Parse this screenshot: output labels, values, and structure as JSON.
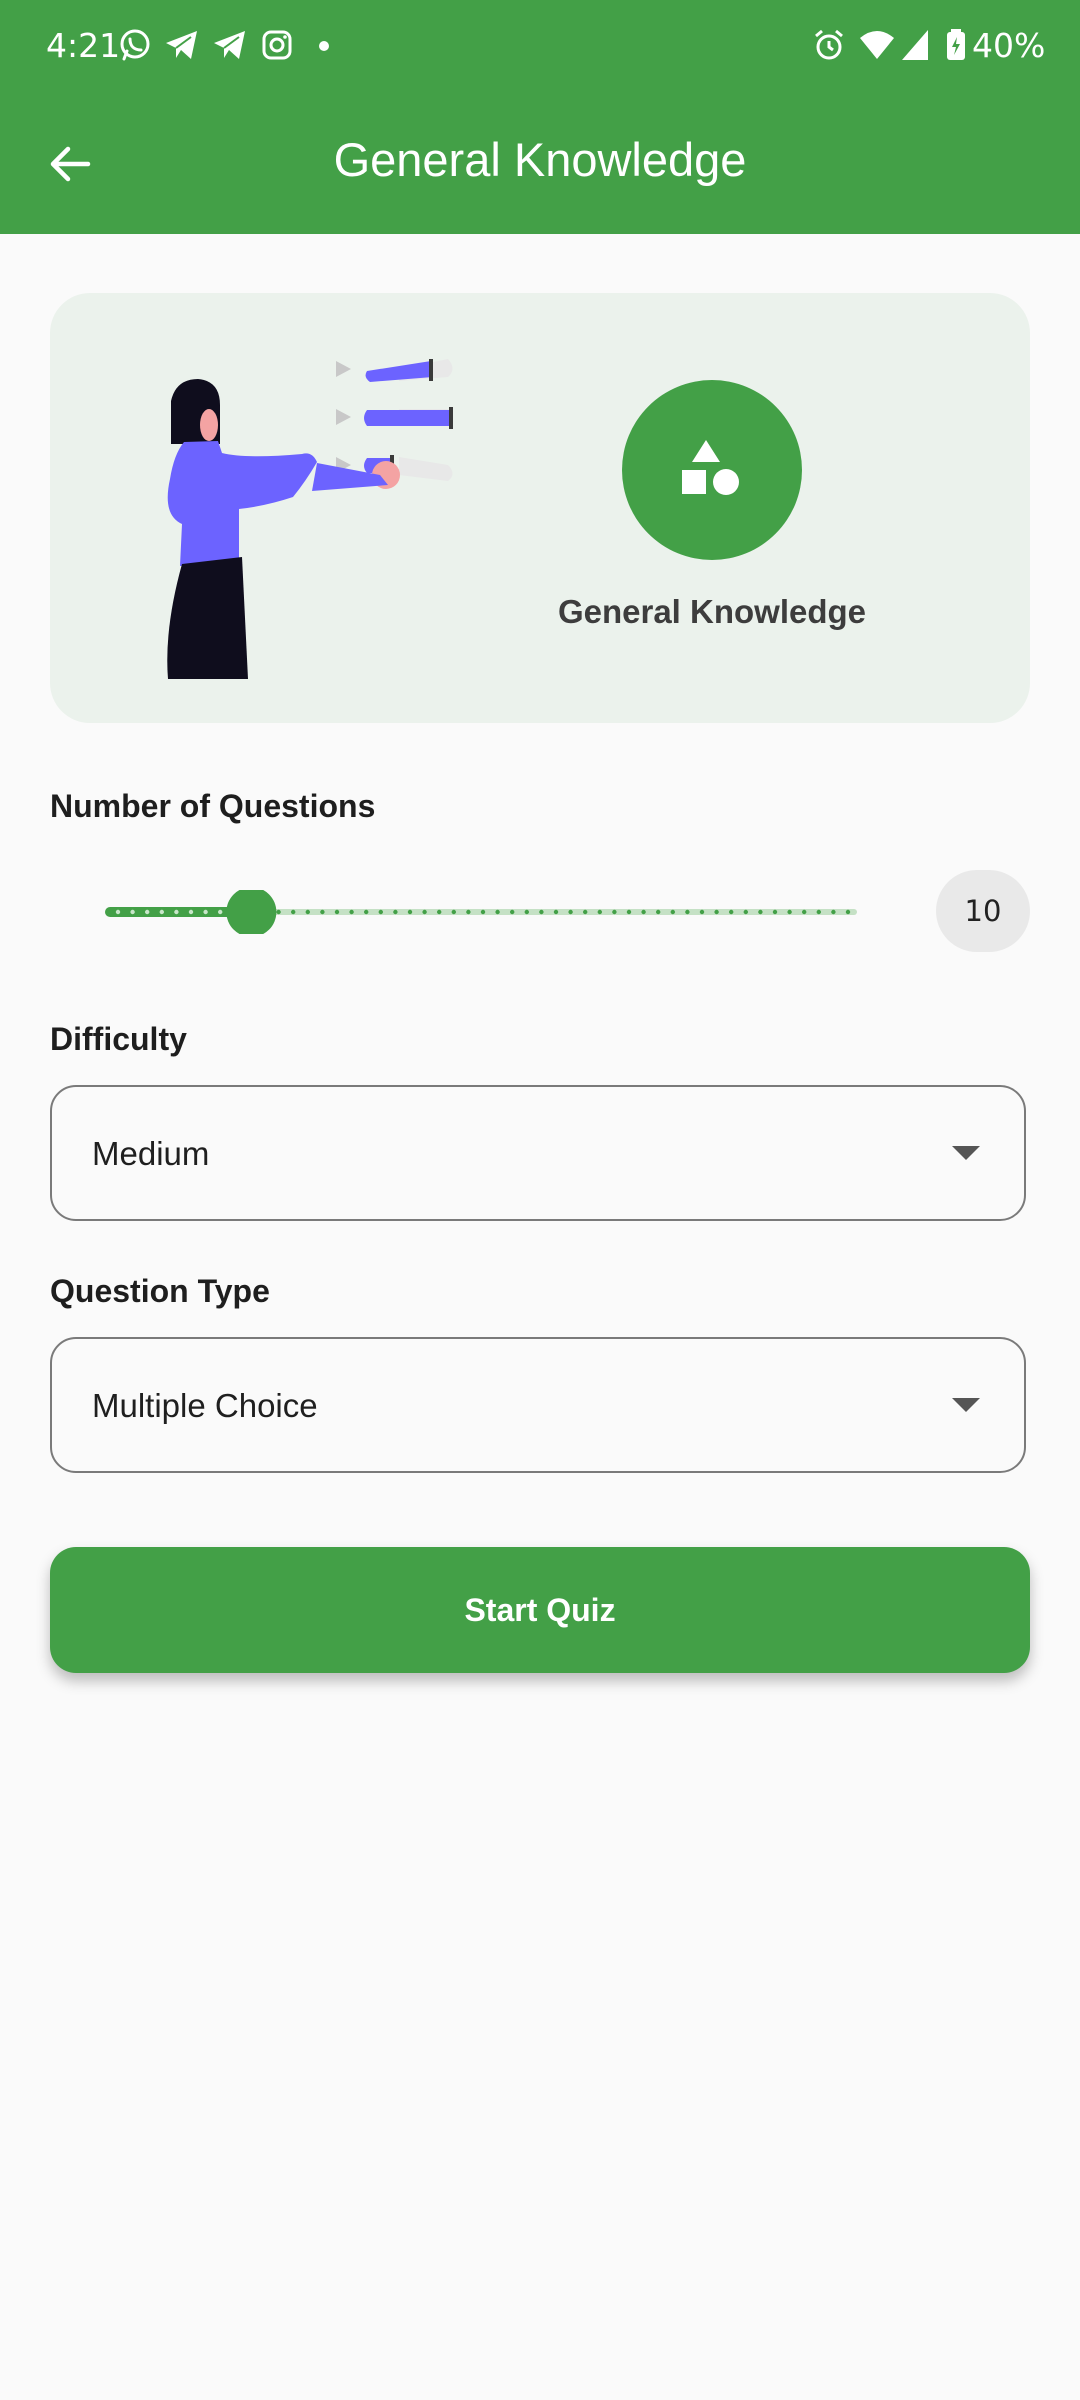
{
  "status_bar": {
    "time": "4:21",
    "battery": "40%",
    "left_icons": [
      "whatsapp-icon",
      "telegram-icon",
      "telegram-icon",
      "instagram-icon",
      "dot-icon"
    ],
    "right_icons": [
      "alarm-icon",
      "wifi-icon",
      "signal-icon",
      "battery-charging-icon"
    ]
  },
  "app_bar": {
    "title": "General Knowledge",
    "back_icon": "arrow-back-icon"
  },
  "hero": {
    "category_label": "General Knowledge",
    "category_icon": "shapes-icon"
  },
  "questions": {
    "label": "Number of Questions",
    "value": "10",
    "slider_fraction": 0.19
  },
  "difficulty": {
    "label": "Difficulty",
    "selected": "Medium"
  },
  "question_type": {
    "label": "Question Type",
    "selected": "Multiple Choice"
  },
  "start_button": {
    "label": "Start Quiz"
  },
  "colors": {
    "primary": "#43a047",
    "hero_bg": "#ebf2ec",
    "illustration_accent": "#6c63ff"
  }
}
